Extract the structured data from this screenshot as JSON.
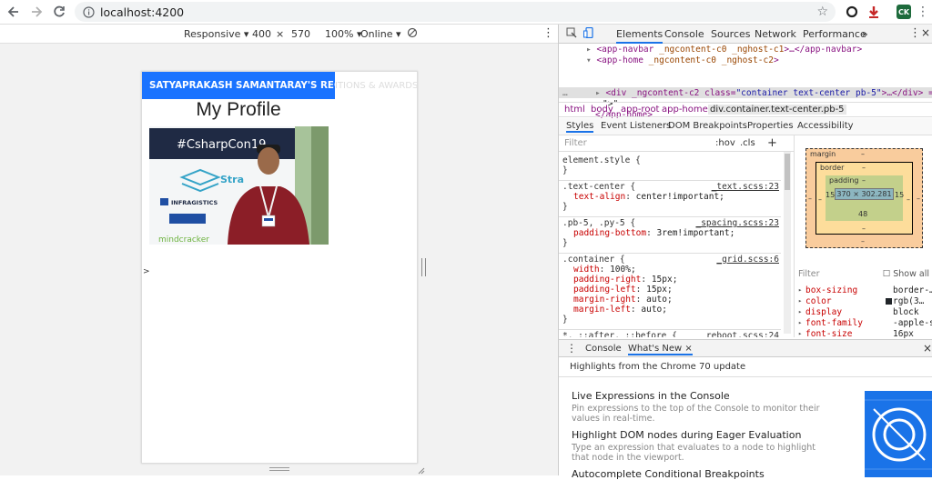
{
  "browser": {
    "url": "localhost:4200",
    "extension_badge": "CK"
  },
  "device_toolbar": {
    "device": "Responsive",
    "width": "400",
    "times": "×",
    "height": "570",
    "zoom": "100%",
    "network": "Online"
  },
  "page": {
    "brand": "SATYAPRAKASH SAMANTARAY'S RECOGN",
    "brand_overflow": "ITIONS & AWARDS",
    "title": "My Profile",
    "photo_banner_text": "#CsharpCon19",
    "photo_sponsor_1": "INFRAGISTICS",
    "photo_sponsor_2": "mindcracker",
    "photo_sponsor_3": "Stra",
    "caret": ">"
  },
  "devtools": {
    "tabs": [
      "Elements",
      "Console",
      "Sources",
      "Network",
      "Performance"
    ],
    "more": "»",
    "dom": {
      "line1_tag": "<app-navbar",
      "line1_attrs": " _ngcontent-c0 _nghost-c1",
      "line1_end": ">…</app-navbar>",
      "line2_tag": "<app-home",
      "line2_attrs": " _ngcontent-c0 _nghost-c2",
      "line2_end": ">",
      "line3_pre": "<div _ngcontent-c2 class=",
      "line3_val": "\"container text-center pb-5\"",
      "line3_end": ">…</div> == $0",
      "line4": "\">\"",
      "line5": "</app-home>"
    },
    "breadcrumbs": [
      "html",
      "body",
      "app-root",
      "app-home",
      "div.container.text-center.pb-5"
    ],
    "sub_tabs": [
      "Styles",
      "Event Listeners",
      "DOM Breakpoints",
      "Properties",
      "Accessibility"
    ],
    "filter_placeholder": "Filter",
    "hov": ":hov",
    "cls": ".cls",
    "plus": "+",
    "rules": [
      {
        "selector": "element.style {",
        "source": "",
        "props": [],
        "close": "}"
      },
      {
        "selector": ".text-center {",
        "source": "_text.scss:23",
        "props": [
          [
            "text-align",
            "center!important;"
          ]
        ],
        "close": "}"
      },
      {
        "selector": ".pb-5, .py-5 {",
        "source": "_spacing.scss:23",
        "props": [
          [
            "padding-bottom",
            "3rem!important;"
          ]
        ],
        "close": "}"
      },
      {
        "selector": ".container {",
        "source": "_grid.scss:6",
        "props": [
          [
            "width",
            "100%;"
          ],
          [
            "padding-right",
            "15px;"
          ],
          [
            "padding-left",
            "15px;"
          ],
          [
            "margin-right",
            "auto;"
          ],
          [
            "margin-left",
            "auto;"
          ]
        ],
        "close": "}"
      },
      {
        "selector": "*, ::after, ::before {",
        "source": "_reboot.scss:24",
        "props": [
          [
            "box-sizing",
            "border-box;"
          ]
        ],
        "close": ""
      }
    ],
    "box_model": {
      "margin_label": "margin",
      "margin_value": "–",
      "border_label": "border",
      "border_value": "–",
      "padding_label": "padding",
      "padding_value": "–",
      "content": "370 × 302.281",
      "padding_left": "15",
      "padding_right": "15",
      "padding_bottom": "48",
      "dash": "–"
    },
    "computed": {
      "filter": "Filter",
      "show_all": "Show all",
      "rows": [
        {
          "name": "box-sizing",
          "value": "border-…"
        },
        {
          "name": "color",
          "value": "rgb(3…"
        },
        {
          "name": "display",
          "value": "block"
        },
        {
          "name": "font-family",
          "value": "-apple-s…"
        },
        {
          "name": "font-size",
          "value": "16px"
        }
      ]
    },
    "drawer_tabs": [
      "Console",
      "What's New"
    ],
    "drawer_close": "×",
    "whats_new": {
      "header": "Highlights from the Chrome 70 update",
      "items": [
        {
          "title": "Live Expressions in the Console",
          "desc": "Pin expressions to the top of the Console to monitor their values in real-time."
        },
        {
          "title": "Highlight DOM nodes during Eager Evaluation",
          "desc": "Type an expression that evaluates to a node to highlight that node in the viewport."
        },
        {
          "title": "Autocomplete Conditional Breakpoints",
          "desc": ""
        }
      ]
    }
  },
  "colors": {
    "brand_bar": "#1a73ff",
    "devtools_accent": "#1a73e8"
  }
}
